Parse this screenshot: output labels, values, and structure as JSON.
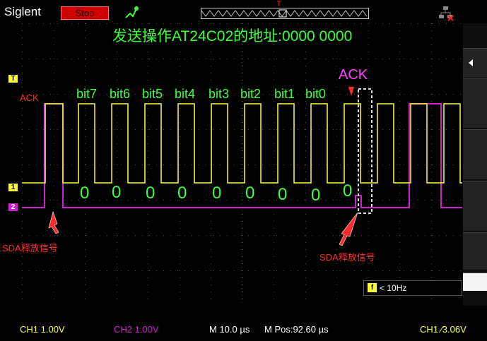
{
  "header": {
    "brand": "Siglent",
    "run_state": "Stop",
    "icons": [
      "trigger-icon",
      "network-disconnected-icon"
    ],
    "trigger_marker": "T"
  },
  "screen": {
    "title": "发送操作AT24C02的地址:0000 0000",
    "bit_labels": [
      "bit7",
      "bit6",
      "bit5",
      "bit4",
      "bit3",
      "bit2",
      "bit1",
      "bit0"
    ],
    "bit_values": [
      "0",
      "0",
      "0",
      "0",
      "0",
      "0",
      "0",
      "0",
      "0"
    ],
    "ack_top": "ACK",
    "ack_left": "ACK",
    "sda_release_left": "SDA释放信号",
    "sda_release_right": "SDA释放信号",
    "ch_markers": {
      "trigger_level": "T",
      "ch1": "1",
      "ch2": "2"
    },
    "filter": {
      "icon": "f",
      "text": "< 10Hz"
    }
  },
  "status": {
    "ch1": "CH1 1.00V",
    "ch2": "CH2 1.00V",
    "timebase": "M 10.0 µs",
    "mpos": "M Pos:92.60 µs",
    "trigger": "CH1 ∕3.06V"
  },
  "colors": {
    "ch1": "#ffff3a",
    "ch2": "#cc22cc",
    "annotation": "#3cff3c",
    "stop": "#d00000",
    "accent_red": "#ff2a2a",
    "ack_magenta": "#ff40ff"
  }
}
